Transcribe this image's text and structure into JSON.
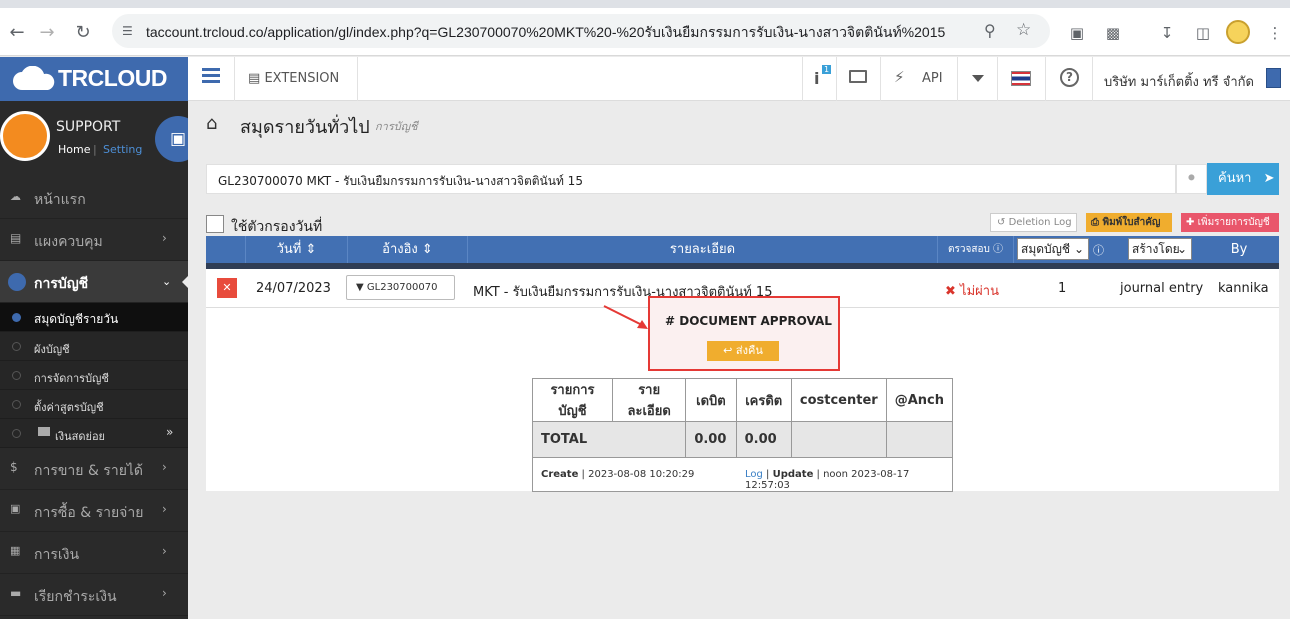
{
  "browser": {
    "url": "taccount.trcloud.co/application/gl/index.php?q=GL230700070%20MKT%20-%20รับเงินยืมกรรมการรับเงิน-นางสาวจิตตินันท์%2015"
  },
  "app": {
    "logo_text": "TRCLOUD",
    "extension_label": "EXTENSION",
    "info_badge": "1",
    "api_label": "API",
    "company_name": "บริษัท มาร์เก็ตติ้ง ทรี จำกัด"
  },
  "sidebar": {
    "user_name": "SUPPORT",
    "home_link": "Home",
    "setting_link": "Setting",
    "items": [
      {
        "label": "หน้าแรก"
      },
      {
        "label": "แผงควบคุม"
      },
      {
        "label": "การบัญชี"
      },
      {
        "label": "การขาย & รายได้"
      },
      {
        "label": "การซื้อ & รายจ่าย"
      },
      {
        "label": "การเงิน"
      },
      {
        "label": "เรียกชำระเงิน"
      }
    ],
    "sub_items": [
      {
        "label": "สมุดบัญชีรายวัน"
      },
      {
        "label": "ผังบัญชี"
      },
      {
        "label": "การจัดการบัญชี"
      },
      {
        "label": "ตั้งค่าสูตรบัญชี"
      },
      {
        "label": "เงินสดย่อย"
      }
    ]
  },
  "page": {
    "title": "สมุดรายวันทั่วไป",
    "subtitle": "การบัญชี",
    "search_value": "GL230700070 MKT - รับเงินยืมกรรมการรับเงิน-นางสาวจิตตินันท์ 15",
    "search_button": "ค้นหา",
    "date_filter_label": "ใช้ตัวกรองวันที่",
    "deletion_log": "Deletion Log",
    "print_button": "พิมพ์ใบสำคัญ",
    "add_button": "เพิ่มรายการบัญชี"
  },
  "table": {
    "headers": {
      "date": "วันที่",
      "ref": "อ้างอิง",
      "detail": "รายละเอียด",
      "check": "ตรวจสอบ",
      "book_select": "สมุดบัญชี",
      "creator_select": "สร้างโดย",
      "by": "By"
    },
    "row": {
      "date": "24/07/2023",
      "ref": "GL230700070",
      "detail": "MKT - รับเงินยืมกรรมการรับเงิน-นางสาวจิตตินันท์ 15",
      "status": "ไม่ผ่าน",
      "book": "1",
      "book_name": "journal entry",
      "by": "kannika"
    }
  },
  "approval": {
    "title": "# DOCUMENT APPROVAL",
    "return_button": "ส่งคืน"
  },
  "subtable": {
    "headers": [
      "รายการบัญชี",
      "รายละเอียด",
      "เดบิต",
      "เครดิต",
      "costcenter",
      "@Anch"
    ],
    "total_label": "TOTAL",
    "total_debit": "0.00",
    "total_credit": "0.00",
    "create_label": "Create",
    "create_time": "2023-08-08 10:20:29",
    "log_link": "Log",
    "update_label": "Update",
    "update_info": "noon 2023-08-17 12:57:03"
  },
  "colors": {
    "brand_blue": "#3e6aae",
    "header_blue": "#4270b3",
    "accent_orange": "#f0ad2e",
    "alert_red": "#e53935"
  }
}
